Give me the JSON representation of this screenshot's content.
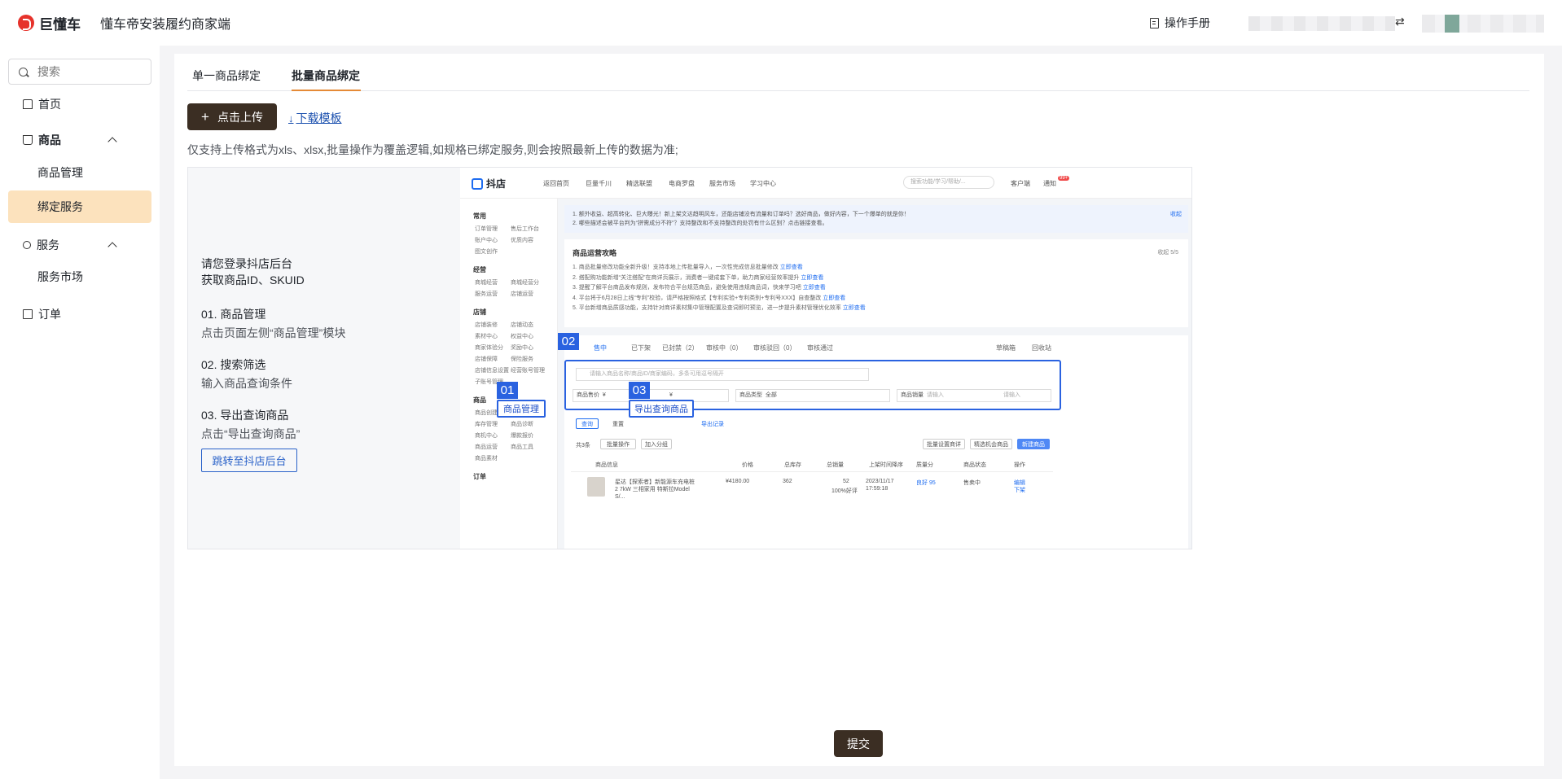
{
  "header": {
    "logo_text": "巨懂车",
    "app_title": "懂车帝安装履约商家端",
    "manual_label": "操作手册",
    "swap_symbol": "⇄"
  },
  "sidebar": {
    "search_placeholder": "搜索",
    "items": [
      {
        "label": "首页",
        "icon": "home-icon"
      },
      {
        "label": "商品",
        "icon": "cart-icon",
        "expanded": true
      },
      {
        "label": "商品管理",
        "sub": true
      },
      {
        "label": "绑定服务",
        "sub": true,
        "active": true
      },
      {
        "label": "服务",
        "icon": "user-icon",
        "expanded": true
      },
      {
        "label": "服务市场",
        "sub": true
      },
      {
        "label": "订单",
        "icon": "order-icon"
      }
    ]
  },
  "tabs": [
    {
      "label": "单一商品绑定",
      "active": false
    },
    {
      "label": "批量商品绑定",
      "active": true
    }
  ],
  "actions": {
    "upload_label": "点击上传",
    "download_label": "下载模板"
  },
  "note": "仅支持上传格式为xls、xlsx,批量操作为覆盖逻辑,如规格已绑定服务,则会按照最新上传的数据为准;",
  "guide": {
    "intro_line1": "请您登录抖店后台",
    "intro_line2": "获取商品ID、SKUID",
    "steps": [
      {
        "title": "01.  商品管理",
        "desc": "点击页面左侧“商品管理”模块"
      },
      {
        "title": "02. 搜索筛选",
        "desc": "输入商品查询条件"
      },
      {
        "title": "03. 导出查询商品",
        "desc": "点击“导出查询商品”"
      }
    ],
    "jump_button": "跳转至抖店后台"
  },
  "screenshot": {
    "logo": "抖店",
    "nav": [
      "返回首页",
      "巨量千川",
      "精选联盟",
      "电商罗盘",
      "服务市场",
      "学习中心"
    ],
    "search_placeholder": "搜索功能/学习/帮助/...",
    "right_items": [
      "客户端",
      "通知"
    ],
    "notice_lines": [
      "1. 额外收益、超高转化、巨大曝光！新上架文达趋明风车，还能店铺没有流量和订单吗？选好商品，做好内容，下一个爆单的就是你！",
      "2. 哪些描述会被平台判为“拼需成分不符”？支持整改和不支持整改的处罚有什么区别？点击链接查看。"
    ],
    "notice_action": "收起",
    "side_groups": [
      "常用",
      "经营",
      "店铺",
      "商品",
      "订单"
    ],
    "side_links": [
      "订单管理",
      "售后工作台",
      "账户中心",
      "优质内容",
      "图文创作",
      "商城经营",
      "商城经营分",
      "服务运营",
      "店铺运营",
      "店铺装修",
      "店铺动态",
      "素材中心",
      "权益中心",
      "商家体验分",
      "奖励中心",
      "店铺保障",
      "保险服务",
      "店铺信息设置",
      "经营账号管理",
      "子账号管理",
      "商品创建",
      "商品诊断",
      "库存管理",
      "商机中心",
      "爆款报价",
      "商品运营",
      "商品工具",
      "商品素材"
    ],
    "panel_title": "商品运营攻略",
    "panel_action": "收起 5/5",
    "panel_lines": [
      "1. 商品批量修改功能全新升级！支持本地上传批量导入，一次性完成信息批量修改",
      "2. 搭配购功能新增“关注搭配”在商详页展示，消费者一键成套下单，助力商家经营效率提升",
      "3. 提醒了解平台商品发布规则，发布符合平台规范商品，避免使用违规商品词，快来学习吧",
      "4. 平台将于6月28日上线“专利”校验，请严格按照格式【专利实验+专利类别+专利号XXX】自查整改",
      "5. 平台新增商品质感功能，支持针对商详素材集中管理配置及查词即时预览，进一步提升素材管理优化效率"
    ],
    "panel_link": "立即查看",
    "list_tabs": [
      "售中",
      "已下架",
      "已封禁（2）",
      "审核中（0）",
      "审核驳回（0）",
      "审核通过"
    ],
    "list_right": [
      "草稿箱",
      "回收站"
    ],
    "keyword_placeholder": "请输入商品名称/商品ID/商家编码，多条可用逗号隔开",
    "filters": [
      {
        "label": "商品售价",
        "value": "¥"
      },
      {
        "label": "",
        "value": "¥"
      },
      {
        "label": "商品类型",
        "value": "全部"
      },
      {
        "label": "商品销量",
        "value": "请输入"
      },
      {
        "label": "",
        "value": "请输入"
      }
    ],
    "query_btn": "查询",
    "reset_btn": "重置",
    "export_record": "导出记录",
    "total": "共3条",
    "bulk_ops": "批量操作",
    "add_group": "加入分组",
    "right_btns": [
      "批量设置商详",
      "精选机会商品",
      "新建商品"
    ],
    "table_headers": [
      "商品信息",
      "价格",
      "总库存",
      "总销量",
      "上架时间降序",
      "质量分",
      "商品状态",
      "操作"
    ],
    "row": {
      "name": "星达【探索者】新能源车充电桩2 7kW 三相家用 特斯拉Model S/...",
      "price": "¥4180.00",
      "stock": "362",
      "sales": "52",
      "sales_sub": "100%好评",
      "date": "2023/11/17",
      "time": "17:59:18",
      "quality": "良好 95",
      "status": "售卖中",
      "op1": "编辑",
      "op2": "下架"
    },
    "notif_badge": "99+",
    "callouts": [
      {
        "num": "01",
        "label": "商品管理"
      },
      {
        "num": "02",
        "label": ""
      },
      {
        "num": "03",
        "label": "导出查询商品"
      }
    ]
  },
  "footer": {
    "submit_label": "提交"
  },
  "colors": {
    "primary_dark": "#3b2e23",
    "active_bg": "#fce2bd",
    "tab_underline": "#e58a36",
    "highlight_blue": "#2a62e0"
  }
}
